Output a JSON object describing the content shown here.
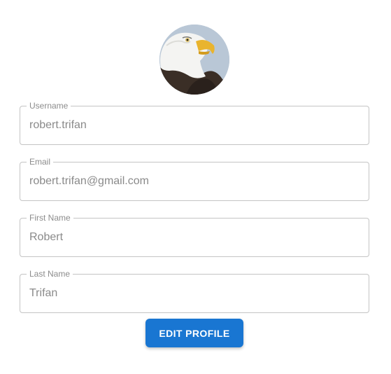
{
  "profile": {
    "avatar_icon": "bald-eagle-photo",
    "fields": [
      {
        "label": "Username",
        "value": "robert.trifan"
      },
      {
        "label": "Email",
        "value": "robert.trifan@gmail.com"
      },
      {
        "label": "First Name",
        "value": "Robert"
      },
      {
        "label": "Last Name",
        "value": "Trifan"
      }
    ],
    "edit_button_label": "EDIT PROFILE"
  },
  "colors": {
    "accent": "#1976d2",
    "field_border": "#c4c4c4",
    "label_text": "#8c8c8c",
    "value_text": "#8a8a8a"
  }
}
